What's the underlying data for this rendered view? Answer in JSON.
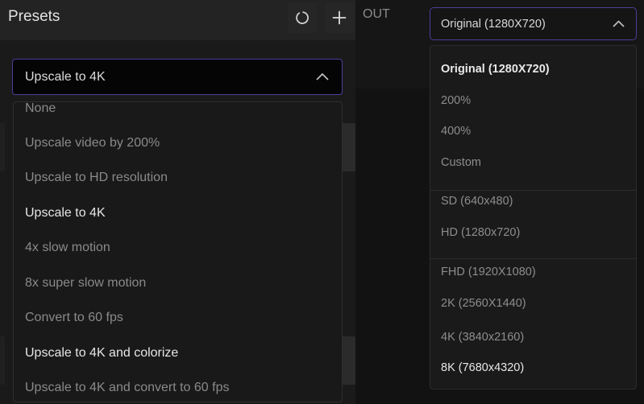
{
  "presets": {
    "title": "Presets",
    "icons": {
      "reset": "reset-icon",
      "add": "plus-icon",
      "chevron": "chevron-up-icon"
    },
    "selected": "Upscale to 4K",
    "options": [
      {
        "label": "None"
      },
      {
        "label": "Upscale video by 200%"
      },
      {
        "label": "Upscale to HD resolution"
      },
      {
        "label": "Upscale to 4K",
        "highlighted": true
      },
      {
        "label": "4x slow motion"
      },
      {
        "label": "8x super slow motion"
      },
      {
        "label": "Convert to 60 fps"
      },
      {
        "label": "Upscale to 4K and colorize",
        "highlighted": true
      },
      {
        "label": "Upscale to 4K and convert to 60 fps"
      }
    ]
  },
  "output": {
    "label": "OUT",
    "selected": "Original (1280X720)",
    "options": [
      {
        "label": "Original (1280X720)",
        "selected": true
      },
      {
        "label": "200%"
      },
      {
        "label": "400%"
      },
      {
        "label": "Custom"
      },
      {
        "label": "SD (640x480)"
      },
      {
        "label": "HD (1280x720)"
      },
      {
        "label": "FHD (1920X1080)"
      },
      {
        "label": "2K (2560X1440)"
      },
      {
        "label": "4K (3840x2160)"
      },
      {
        "label": "8K (7680x4320)",
        "highlighted": true
      }
    ]
  },
  "colors": {
    "accent_border": "#4b3f9a",
    "background": "#121212",
    "menu_background": "#191919",
    "text_primary": "#e6e6e6",
    "text_muted": "#8a8a8a"
  }
}
